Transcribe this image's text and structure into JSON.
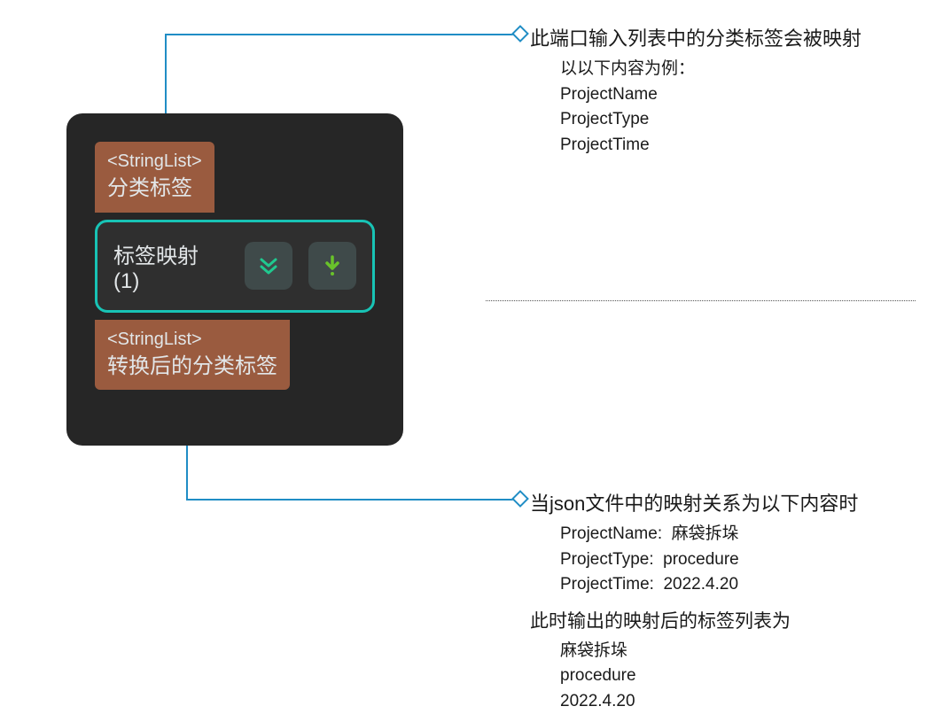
{
  "node": {
    "input": {
      "type": "<StringList>",
      "label": "分类标签"
    },
    "center": {
      "label": "标签映射 (1)",
      "icon1_name": "double-chevron-down-icon",
      "icon2_name": "download-arrow-icon"
    },
    "output": {
      "type": "<StringList>",
      "label": "转换后的分类标签"
    }
  },
  "callout_top": {
    "title": "此端口输入列表中的分类标签会被映射",
    "subtitle": "以以下内容为例：",
    "items": [
      "ProjectName",
      "ProjectType",
      "ProjectTime"
    ]
  },
  "callout_bottom": {
    "title": "当json文件中的映射关系为以下内容时",
    "mappings": [
      "ProjectName:  麻袋拆垛",
      "ProjectType:  procedure",
      "ProjectTime:  2022.4.20"
    ],
    "result_title": "此时输出的映射后的标签列表为",
    "results": [
      "麻袋拆垛",
      "procedure",
      "2022.4.20"
    ]
  },
  "colors": {
    "accent": "#208dc5",
    "teal": "#18c3b5",
    "port_bg": "#9a5b3f",
    "panel_bg": "#262626"
  }
}
